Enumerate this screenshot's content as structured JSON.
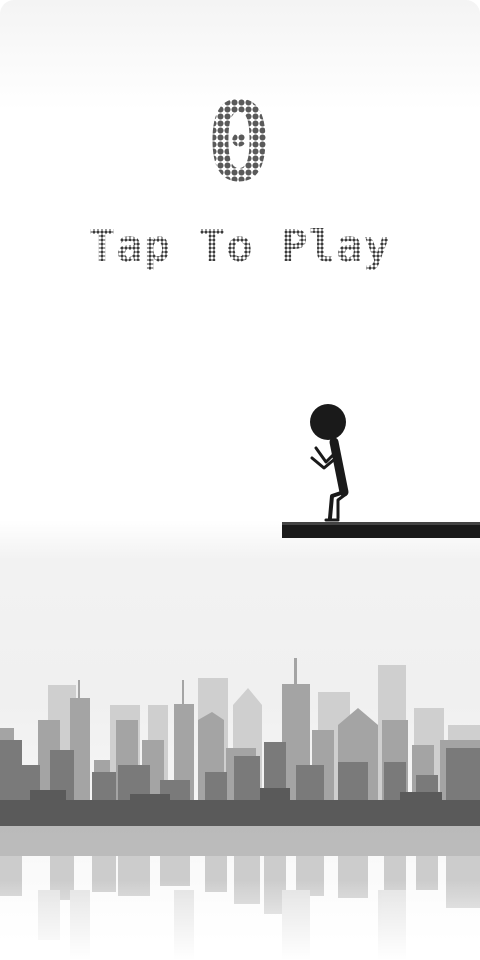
{
  "hud": {
    "score": "0",
    "prompt": "Tap To Play"
  },
  "colors": {
    "score": "#5a5a5a",
    "prompt": "#3a3a3a",
    "player": "#1a1a1a",
    "platform": "#1a1a1a",
    "skyline_back": "#c8c8c8",
    "skyline_mid": "#9a9a9a",
    "skyline_front": "#6e6e6e",
    "skyline_ground": "#555555"
  },
  "sprites": {
    "player": "stickman-crouching",
    "platform": "ledge",
    "background": "city-skyline-with-reflection"
  }
}
